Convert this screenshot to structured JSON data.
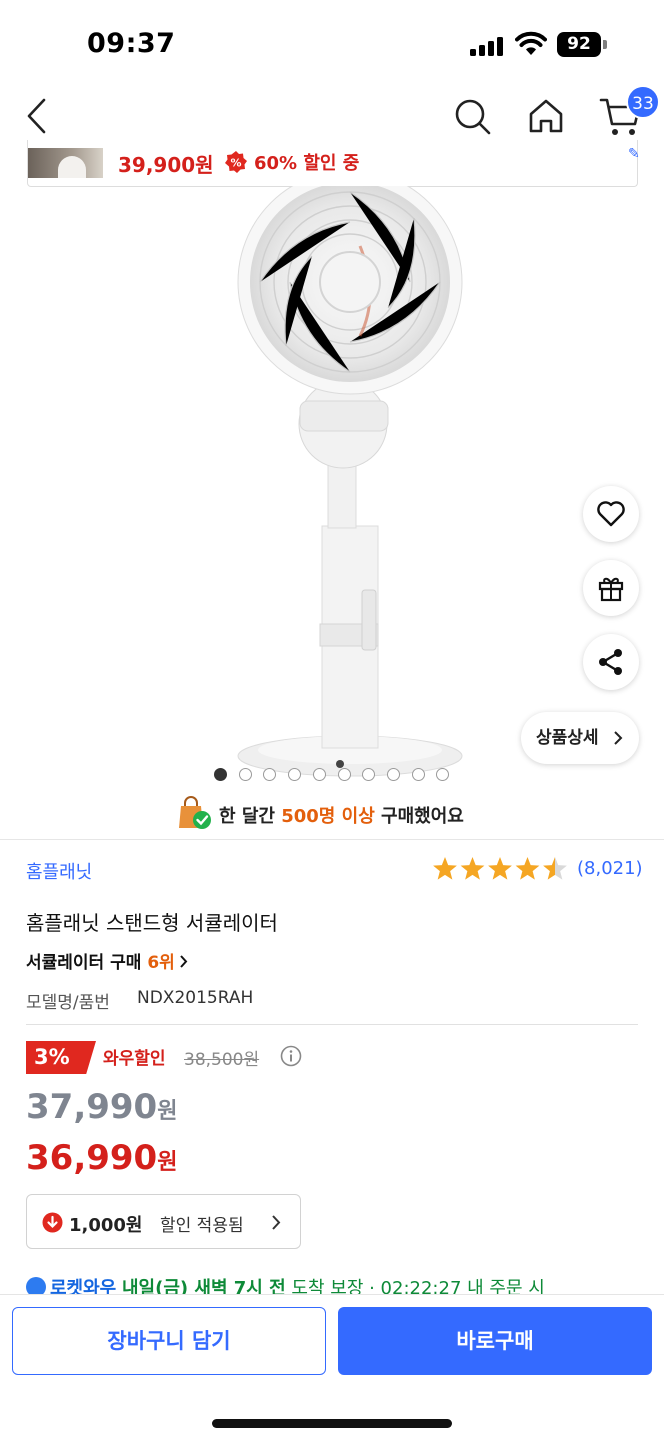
{
  "status_bar": {
    "time": "09:37",
    "battery": "92"
  },
  "nav": {
    "cart_count": "33"
  },
  "price_banner": {
    "price": "39,900원",
    "discount": "60% 할인 중"
  },
  "carousel": {
    "total": 10,
    "active": 0
  },
  "detail_button": {
    "label": "상품상세"
  },
  "purchase_notice": {
    "prefix": "한 달간",
    "highlight": "500명 이상",
    "suffix": "구매했어요"
  },
  "product": {
    "brand": "홈플래닛",
    "rating": 4.5,
    "review_count": "(8,021)",
    "title": "홈플래닛 스탠드형 서큘레이터",
    "rank_category": "서큘레이터 구매",
    "rank_value": "6위",
    "model_label": "모델명/품번",
    "model_value": "NDX2015RAH"
  },
  "pricing": {
    "discount_percent": "3%",
    "discount_label": "와우할인",
    "original_price": "38,500원",
    "wow_price": "37,990",
    "final_price": "36,990",
    "currency": "원"
  },
  "coupon": {
    "amount": "1,000원",
    "text": "할인 적용됨"
  },
  "delivery": {
    "rocket": "로켓와우",
    "day": "내일(금) 새벽 7시 전",
    "rest": "도착 보장 · 02:22:27 내 주문 시"
  },
  "actions": {
    "cart": "장바구니 담기",
    "buy": "바로구매"
  },
  "colors": {
    "accent": "#346aff",
    "price_red": "#d4201b",
    "highlight_orange": "#e35f0c",
    "star": "#f5a623"
  }
}
